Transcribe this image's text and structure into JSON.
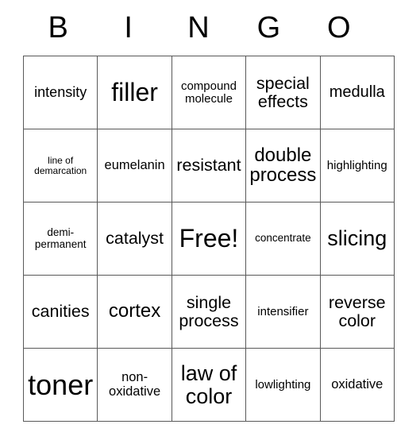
{
  "card": {
    "title": "BINGO",
    "header_letters": [
      "B",
      "I",
      "N",
      "G",
      "O"
    ],
    "free_space_label": "Free!",
    "rows": [
      [
        {
          "text": "intensity",
          "size": "s-mdb"
        },
        {
          "text": "filler",
          "size": "s-hug"
        },
        {
          "text": "compound molecule",
          "size": "s-smb"
        },
        {
          "text": "special effects",
          "size": "s-lgb"
        },
        {
          "text": "medulla",
          "size": "s-lg"
        }
      ],
      [
        {
          "text": "line of demarcation",
          "size": "s-xs"
        },
        {
          "text": "eumelanin",
          "size": "s-md"
        },
        {
          "text": "resistant",
          "size": "s-lgb"
        },
        {
          "text": "double process",
          "size": "s-xl"
        },
        {
          "text": "highlighting",
          "size": "s-smb"
        }
      ],
      [
        {
          "text": "demi-permanent",
          "size": "s-sm"
        },
        {
          "text": "catalyst",
          "size": "s-lgb"
        },
        {
          "text": "Free!",
          "size": "s-hug"
        },
        {
          "text": "concentrate",
          "size": "s-sm"
        },
        {
          "text": "slicing",
          "size": "s-xxl"
        }
      ],
      [
        {
          "text": "canities",
          "size": "s-lgb"
        },
        {
          "text": "cortex",
          "size": "s-xl"
        },
        {
          "text": "single process",
          "size": "s-lgb"
        },
        {
          "text": "intensifier",
          "size": "s-smb"
        },
        {
          "text": "reverse color",
          "size": "s-lgb"
        }
      ],
      [
        {
          "text": "toner",
          "size": "s-max"
        },
        {
          "text": "non-oxidative",
          "size": "s-md"
        },
        {
          "text": "law of color",
          "size": "s-xxl"
        },
        {
          "text": "lowlighting",
          "size": "s-smb"
        },
        {
          "text": "oxidative",
          "size": "s-md"
        }
      ]
    ]
  },
  "colors": {
    "background": "#ffffff",
    "text": "#000000",
    "grid_line": "#595959"
  }
}
